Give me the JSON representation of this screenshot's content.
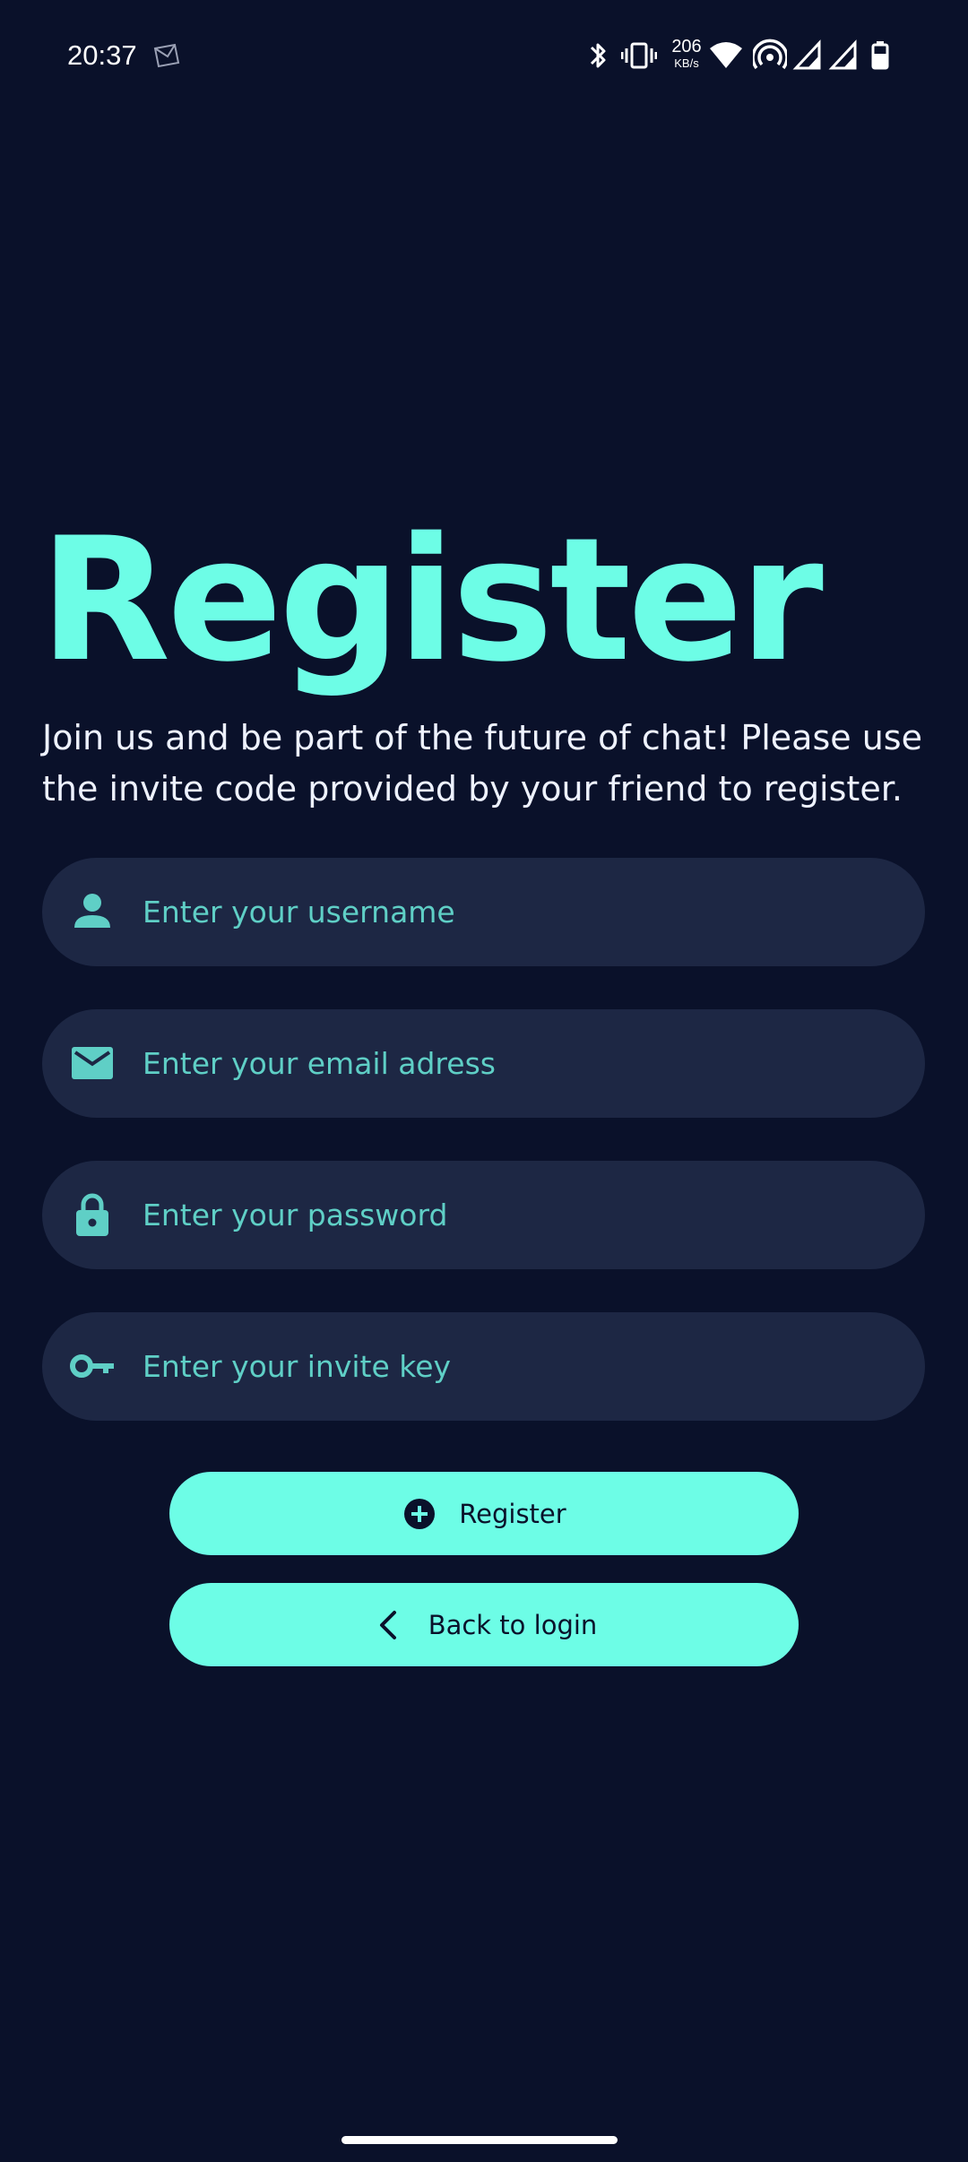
{
  "status_bar": {
    "time": "20:37",
    "net_speed_value": "206",
    "net_speed_unit": "KB/s",
    "icons": [
      "mail-icon",
      "bluetooth-icon",
      "vibrate-icon",
      "wifi-icon",
      "hotspot-icon",
      "signal-icon",
      "signal-icon",
      "battery-icon"
    ]
  },
  "header": {
    "title": "Register",
    "subtitle": "Join us and be part of the future of chat! Please use the invite code provided by your friend to register."
  },
  "form": {
    "username": {
      "placeholder": "Enter your username",
      "icon": "person-icon"
    },
    "email": {
      "placeholder": "Enter your email adress",
      "icon": "mail-icon"
    },
    "password": {
      "placeholder": "Enter your password",
      "icon": "lock-icon"
    },
    "invite_key": {
      "placeholder": "Enter your invite key",
      "icon": "key-icon"
    }
  },
  "buttons": {
    "register_label": "Register",
    "back_label": "Back to login"
  },
  "colors": {
    "background": "#0a112a",
    "accent": "#6dfde6",
    "field_background": "#1d2744",
    "placeholder": "#5fcfc6"
  }
}
